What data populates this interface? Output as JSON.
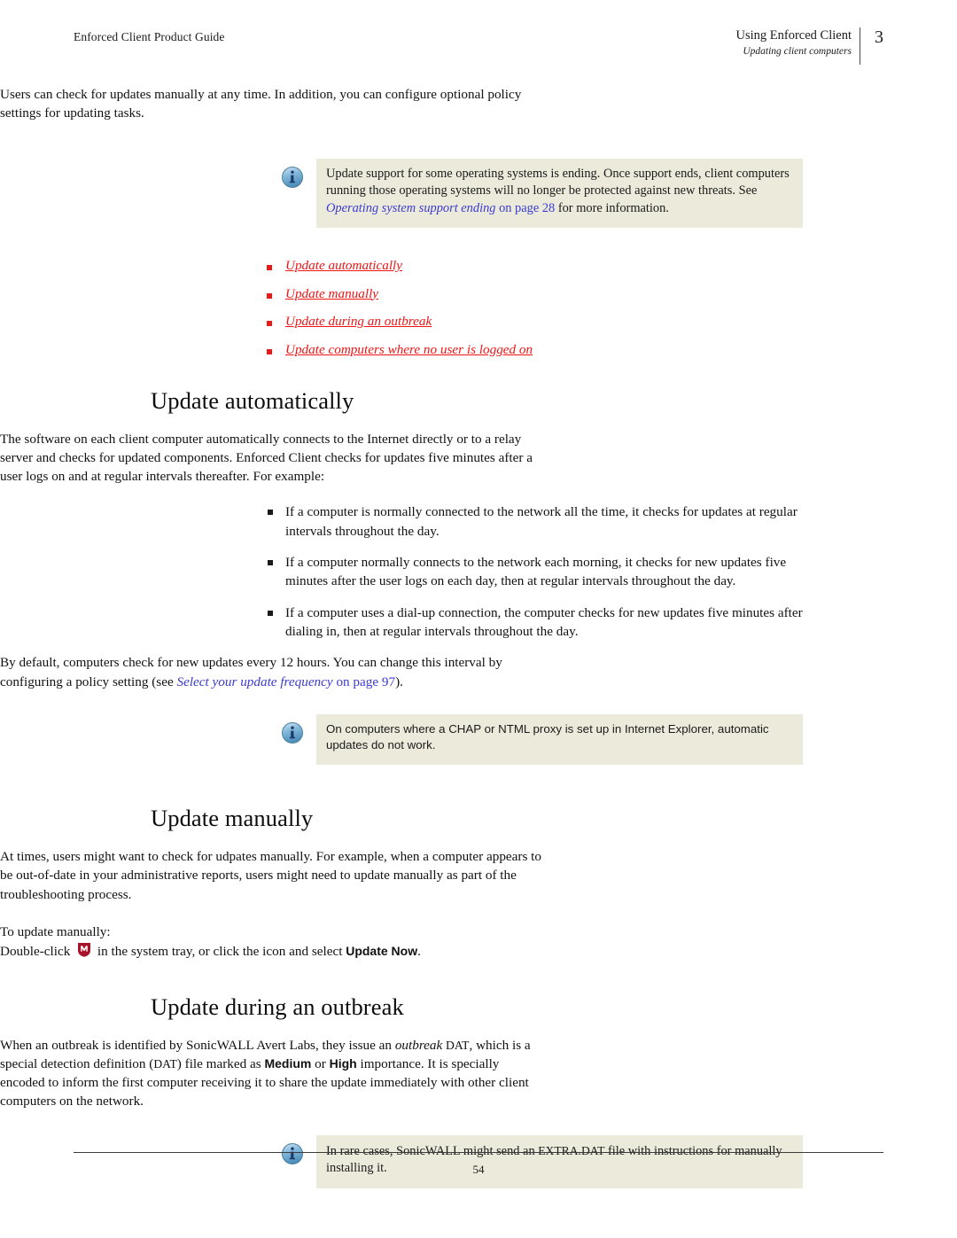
{
  "header": {
    "left_text": "Enforced Client Product Guide",
    "chapter_title": "Using Enforced Client",
    "section_title": "Updating client computers",
    "chapter_number": "3"
  },
  "intro": {
    "paragraph": "Users can check for updates manually at any time. In addition, you can configure optional policy settings for updating tasks."
  },
  "note1": {
    "icon": "info-icon",
    "text_part1": "Update support for some operating systems is ending. Once support ends, client computers running those operating systems will no longer be protected against new threats. See ",
    "link_italic": "Operating system support ending",
    "link_plain": " on page 28",
    "text_part2": " for more information."
  },
  "linklist": {
    "items": [
      {
        "label": "Update automatically"
      },
      {
        "label": "Update manually"
      },
      {
        "label": "Update during an outbreak"
      },
      {
        "label": "Update computers where no user is logged on"
      }
    ]
  },
  "section_auto": {
    "heading": "Update automatically",
    "paragraph": "The software on each client computer automatically connects to the Internet directly or to a relay server and checks for updated components. Enforced Client checks for updates five minutes after a user logs on and at regular intervals thereafter. For example:",
    "bullets": [
      "If a computer is normally connected to the network all the time, it checks for updates at regular intervals throughout the day.",
      "If a computer normally connects to the network each morning, it checks for new updates five minutes after the user logs on each day, then at regular intervals throughout the day.",
      "If a computer uses a dial-up connection, the computer checks for new updates five minutes after dialing in, then at regular intervals throughout the day."
    ],
    "default_text_part1": "By default, computers check for new updates every 12 hours. You can change this interval by configuring a policy setting (see ",
    "default_link_italic": "Select your update frequency",
    "default_link_plain": " on page 97",
    "default_text_part2": ")."
  },
  "note2": {
    "icon": "info-icon",
    "text": "On computers where a CHAP or NTML proxy is set up in Internet Explorer, automatic updates do not work."
  },
  "section_manual": {
    "heading": "Update manually",
    "paragraph": "At times, users might want to check for udpates manually. For example, when a computer appears to be out-of-date in your administrative reports, users might need to update manually as part of the troubleshooting process.",
    "intro_line": "To update manually:",
    "instruction_part1": "Double-click ",
    "instruction_icon": "mcafee-tray-icon",
    "instruction_part2": " in the system tray, or click the icon and select ",
    "instruction_bold": "Update Now",
    "instruction_part3": "."
  },
  "section_outbreak": {
    "heading": "Update during an outbreak",
    "para_part1": "When an outbreak is identified by SonicWALL Avert Labs, they issue an ",
    "para_italic1": "outbreak",
    "para_smallcaps1": "DAT",
    "para_part2": ", which is a special detection definition (",
    "para_smallcaps2": "DAT",
    "para_part3": ") file marked as ",
    "para_bold1": "Medium",
    "para_part4": " or ",
    "para_bold2": "High",
    "para_part5": " importance. It is specially encoded to inform the first computer receiving it to share the update immediately with other client computers on the network."
  },
  "note3": {
    "icon": "info-icon",
    "text_part1": "In rare cases, SonicWALL might send an ",
    "text_smallcaps": "EXTRA.DAT",
    "text_part2": " file with instructions for manually installing it."
  },
  "footer": {
    "page_number": "54"
  },
  "colors": {
    "red_link": "#ef1515",
    "blue_link": "#3b3bd0",
    "note_background": "#eceadb",
    "mcafee_red": "#a8132c",
    "info_blue": "#6fb0da"
  }
}
